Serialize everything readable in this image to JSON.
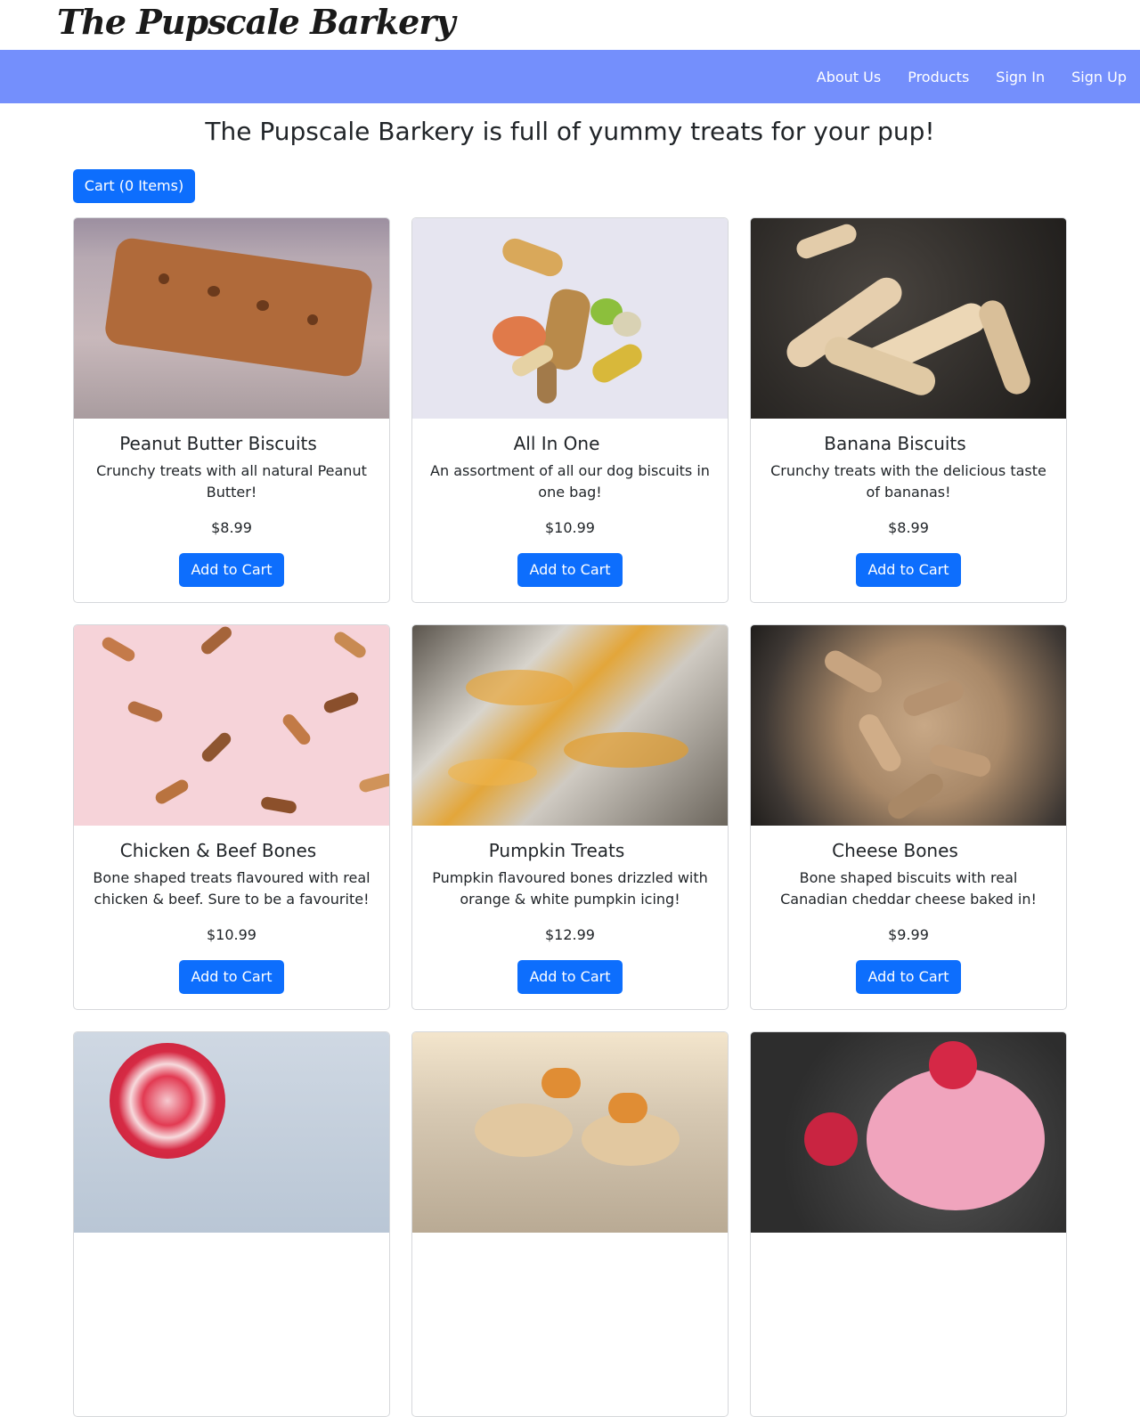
{
  "brand": "The Pupscale Barkery",
  "nav": {
    "items": [
      "About Us",
      "Products",
      "Sign In",
      "Sign Up"
    ]
  },
  "headline": "The Pupscale Barkery is full of yummy treats for your pup!",
  "cart": {
    "label": "Cart (0 Items)"
  },
  "products": [
    {
      "title": "Peanut Butter Biscuits",
      "desc": "Crunchy treats with all natural Peanut Butter!",
      "price": "$8.99",
      "button": "Add to Cart",
      "image": "peanut-butter-biscuit-photo"
    },
    {
      "title": "All In One",
      "desc": "An assortment of all our dog biscuits in one bag!",
      "price": "$10.99",
      "button": "Add to Cart",
      "image": "assorted-biscuits-photo"
    },
    {
      "title": "Banana Biscuits",
      "desc": "Crunchy treats with the delicious taste of bananas!",
      "price": "$8.99",
      "button": "Add to Cart",
      "image": "banana-biscuits-photo"
    },
    {
      "title": "Chicken & Beef Bones",
      "desc": "Bone shaped treats flavoured with real chicken & beef. Sure to be a favourite!",
      "price": "$10.99",
      "button": "Add to Cart",
      "image": "chicken-beef-bones-photo"
    },
    {
      "title": "Pumpkin Treats",
      "desc": "Pumpkin flavoured bones drizzled with orange & white pumpkin icing!",
      "price": "$12.99",
      "button": "Add to Cart",
      "image": "pumpkin-treats-photo"
    },
    {
      "title": "Cheese Bones",
      "desc": "Bone shaped biscuits with real Canadian cheddar cheese baked in!",
      "price": "$9.99",
      "button": "Add to Cart",
      "image": "cheese-bones-photo"
    }
  ],
  "more_products_images": [
    "lollipop-photo",
    "pupcake-photo",
    "cupcake-photo"
  ]
}
